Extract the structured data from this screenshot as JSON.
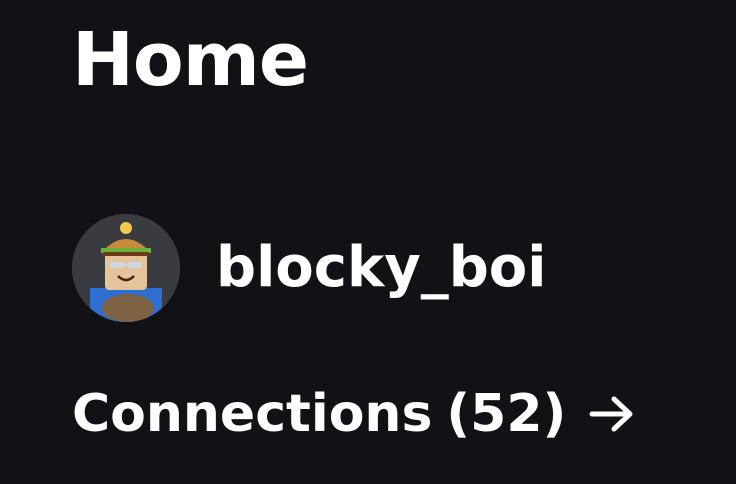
{
  "header": {
    "title": "Home"
  },
  "profile": {
    "username": "blocky_boi",
    "avatar_icon": "avatar-icon"
  },
  "connections": {
    "label": "Connections",
    "count": "(52)",
    "arrow_icon": "arrow-right-icon"
  },
  "colors": {
    "background": "#121216",
    "text": "#ffffff",
    "avatar_bg": "#3a3b40"
  }
}
